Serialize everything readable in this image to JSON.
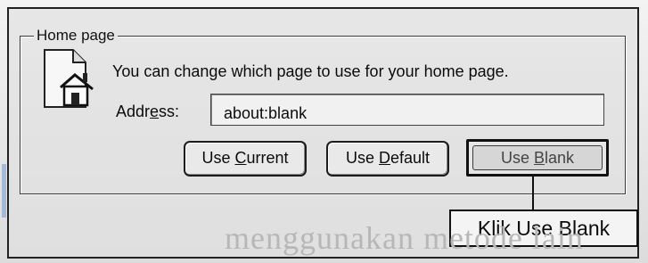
{
  "group": {
    "title": "Home page"
  },
  "info_text": "You can change which page to use for your home page.",
  "address": {
    "label_pre": "Addr",
    "label_ul": "e",
    "label_post": "ss:",
    "value": "about:blank"
  },
  "buttons": {
    "use_current": {
      "pre": "Use ",
      "ul": "C",
      "post": "urrent"
    },
    "use_default": {
      "pre": "Use ",
      "ul": "D",
      "post": "efault"
    },
    "use_blank": {
      "pre": "Use ",
      "ul": "B",
      "post": "lank"
    }
  },
  "callout": {
    "text": "Klik Use Blank"
  },
  "page_text": {
    "line1": "menggunakan metode lain"
  },
  "icons": {
    "home": "home-page-icon"
  }
}
